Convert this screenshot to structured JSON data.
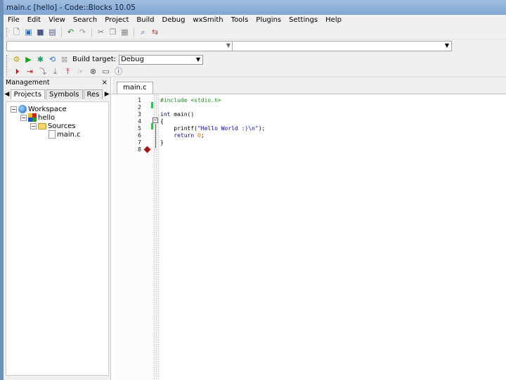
{
  "window": {
    "title": "main.c [hello] - Code::Blocks 10.05"
  },
  "menu": [
    "File",
    "Edit",
    "View",
    "Search",
    "Project",
    "Build",
    "Debug",
    "wxSmith",
    "Tools",
    "Plugins",
    "Settings",
    "Help"
  ],
  "build": {
    "target_label": "Build target:",
    "target_value": "Debug"
  },
  "management": {
    "title": "Management",
    "close": "×",
    "tabs": [
      "Projects",
      "Symbols",
      "Res"
    ],
    "tree": {
      "workspace": "Workspace",
      "project": "hello",
      "folder": "Sources",
      "file": "main.c"
    }
  },
  "editor": {
    "tab": "main.c",
    "line_numbers": [
      "1",
      "2",
      "3",
      "4",
      "5",
      "6",
      "7",
      "8"
    ],
    "code": {
      "l1": "#include <stdio.h>",
      "l3a": "int",
      "l3b": " main()",
      "l4": "{",
      "l5a": "    printf(",
      "l5b": "\"Hello World :)\\n\"",
      "l5c": ");",
      "l6a": "    return",
      "l6b": " 0",
      "l6c": ";",
      "l7": "}"
    }
  },
  "icons": [
    "new-file-icon",
    "open-icon",
    "save-icon",
    "save-all-icon",
    "undo-icon",
    "redo-icon",
    "cut-icon",
    "copy-icon",
    "paste-icon",
    "find-icon",
    "replace-icon",
    "build-icon",
    "run-icon",
    "build-run-icon",
    "rebuild-icon",
    "abort-icon",
    "debug-icon",
    "breakpoint-icon"
  ],
  "colors": {
    "titlebar": "#8eb2dc",
    "breakpoint": "#a01818",
    "change_marker": "#2ec04e"
  }
}
